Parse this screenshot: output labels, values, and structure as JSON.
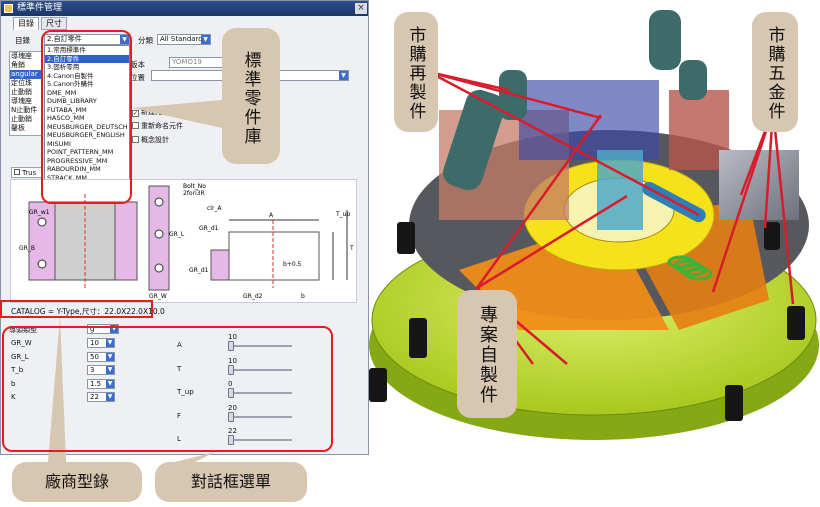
{
  "window": {
    "title": "標準件管理",
    "close": "×"
  },
  "tabs": [
    {
      "label": "目錄"
    },
    {
      "label": "尺寸"
    }
  ],
  "catalog": {
    "label": "目錄",
    "value": "2.自訂零件",
    "classify_label": "分類",
    "classify_value": "All Standards",
    "version_label": "版本",
    "version_value": "YOMO19",
    "position_label": "位置",
    "dropdown_options": [
      "1.常用標準件",
      "2.自訂零件",
      "3.固析零用",
      "4.Canon自製件",
      "5.Canon外購件",
      "DME_MM",
      "DUMB_LIBRARY",
      "FUTABA_MM",
      "HASCO_MM",
      "MEUSBURGER_DEUTSCH",
      "MEUSBURGER_ENGLISH",
      "MISUMI",
      "POINT_PATTERN_MM",
      "PROGRESSIVE_MM",
      "RABOURDIN_MM",
      "STRACK_MM"
    ],
    "selected_index": 1
  },
  "left_list": [
    "導塊座",
    "角銷",
    "angular",
    "定位珠",
    "止動銷",
    "導塊座",
    "N止動件",
    "止動銷",
    "鑿板"
  ],
  "checkboxes": [
    {
      "label": "新建元件",
      "checked": true
    },
    {
      "label": "重新命名元件",
      "checked": false
    },
    {
      "label": "概念設計",
      "checked": false
    }
  ],
  "preview_tab": "Trus",
  "drawing_labels": [
    "Bolt_No",
    "2fori3R",
    "clr_A",
    "A",
    "GR_d1",
    "GR_w1",
    "T_up",
    "T",
    "b+0.5",
    "GR_B",
    "GR_L",
    "GR_W",
    "GR_d2",
    "GR_d1",
    "b"
  ],
  "catalog_text": "CATALOG = Y-Type,尺寸：22.0X22.0X10.0",
  "params": {
    "type_label": "導頭類型",
    "type_value": "g",
    "left": [
      {
        "name": "GR_W",
        "value": "10"
      },
      {
        "name": "GR_L",
        "value": "50"
      },
      {
        "name": "T_b",
        "value": "3"
      },
      {
        "name": "b",
        "value": "1.5"
      },
      {
        "name": "K",
        "value": "22"
      }
    ],
    "right": [
      {
        "name": "A",
        "value": "10"
      },
      {
        "name": "T",
        "value": "10"
      },
      {
        "name": "T_up",
        "value": "0"
      },
      {
        "name": "F",
        "value": "20"
      },
      {
        "name": "L",
        "value": "22"
      }
    ]
  },
  "callouts": {
    "std_library": "標準零件庫",
    "vendor_catalog": "廠商型錄",
    "dialog_menu": "對話框選單",
    "purchased_remade": "市購再製件",
    "purchased_hardware": "市購五金件",
    "project_made": "專案自製件"
  },
  "colors": {
    "callout_bg": "#d7c6b0",
    "highlight": "#e02020",
    "arrow": "#d81c2c",
    "selection": "#2f62c8"
  }
}
